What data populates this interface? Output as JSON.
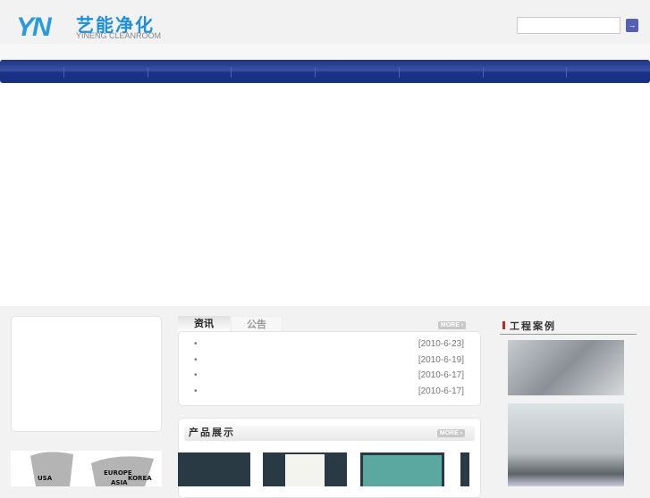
{
  "header": {
    "logo_mark": "YN",
    "logo_cn": "艺能净化",
    "logo_en": "YINENG CLEANROOM",
    "search_placeholder": "",
    "search_button": "→"
  },
  "nav": {
    "items": [
      "",
      "",
      "",
      "",
      "",
      "",
      "",
      ""
    ]
  },
  "news": {
    "tabs": [
      "资讯",
      "公告"
    ],
    "more": "MORE ›",
    "items": [
      {
        "bullet": "•",
        "date": "[2010-6-23]"
      },
      {
        "bullet": "•",
        "date": "[2010-6-19]"
      },
      {
        "bullet": "•",
        "date": "[2010-6-17]"
      },
      {
        "bullet": "•",
        "date": "[2010-6-17]"
      }
    ]
  },
  "products": {
    "title": "产品展示",
    "more": "MORE ›"
  },
  "cases": {
    "title": "工程案例"
  },
  "map": {
    "labels": [
      "USA",
      "EUROPE",
      "KOREA",
      "ASIA"
    ]
  }
}
